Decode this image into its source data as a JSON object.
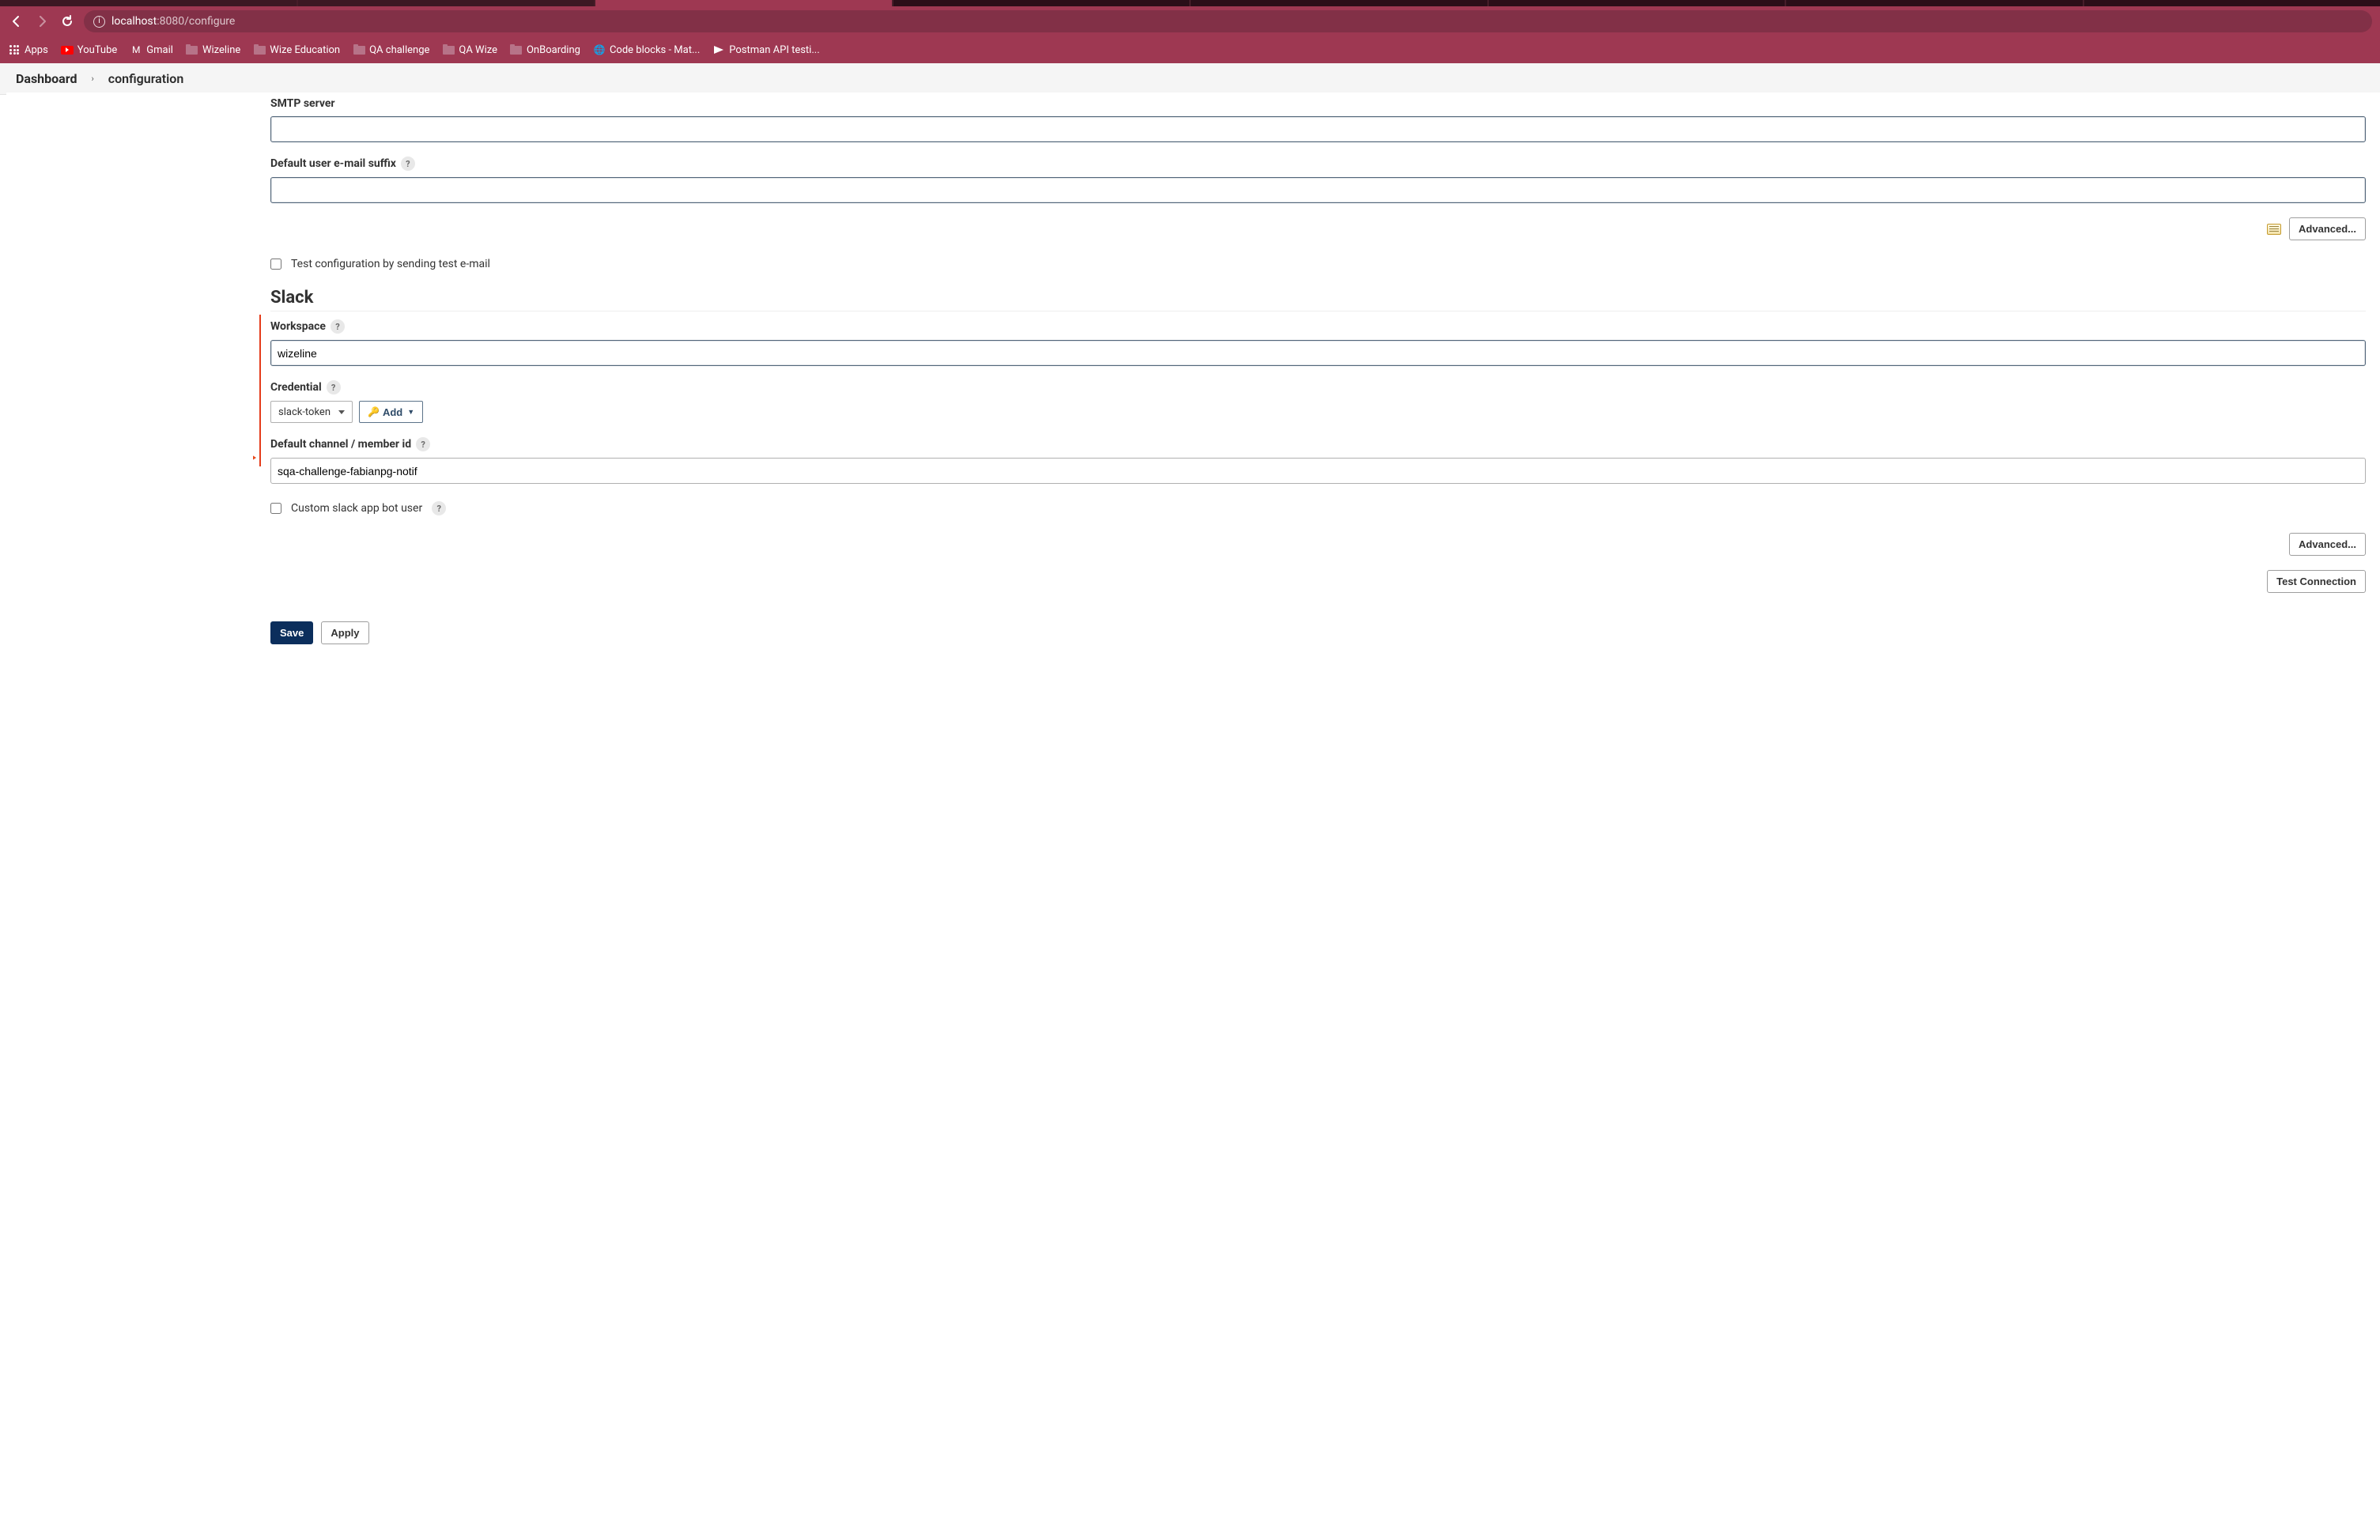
{
  "browser": {
    "url_host": "localhost",
    "url_port": ":8080",
    "url_path": "/configure"
  },
  "bookmarks": {
    "apps": "Apps",
    "youtube": "YouTube",
    "gmail": "Gmail",
    "wizeline": "Wizeline",
    "wize_education": "Wize Education",
    "qa_challenge": "QA challenge",
    "qa_wize": "QA Wize",
    "onboarding": "OnBoarding",
    "code_blocks": "Code blocks - Mat...",
    "postman": "Postman API testi..."
  },
  "breadcrumb": {
    "root": "Dashboard",
    "leaf": "configuration",
    "sep": "›"
  },
  "sections": {
    "smtp": {
      "server_label": "SMTP server",
      "server_value": "",
      "suffix_label": "Default user e-mail suffix",
      "suffix_value": "",
      "advanced_btn": "Advanced...",
      "test_config_label": "Test configuration by sending test e-mail"
    },
    "slack": {
      "heading": "Slack",
      "workspace_label": "Workspace",
      "workspace_value": "wizeline",
      "credential_label": "Credential",
      "credential_value": "slack-token",
      "add_btn": "Add",
      "default_channel_label": "Default channel / member id",
      "default_channel_value": "sqa-challenge-fabianpg-notif",
      "custom_bot_label": "Custom slack app bot user",
      "advanced_btn": "Advanced...",
      "test_connection_btn": "Test Connection"
    }
  },
  "actions": {
    "save": "Save",
    "apply": "Apply"
  },
  "help": "?"
}
